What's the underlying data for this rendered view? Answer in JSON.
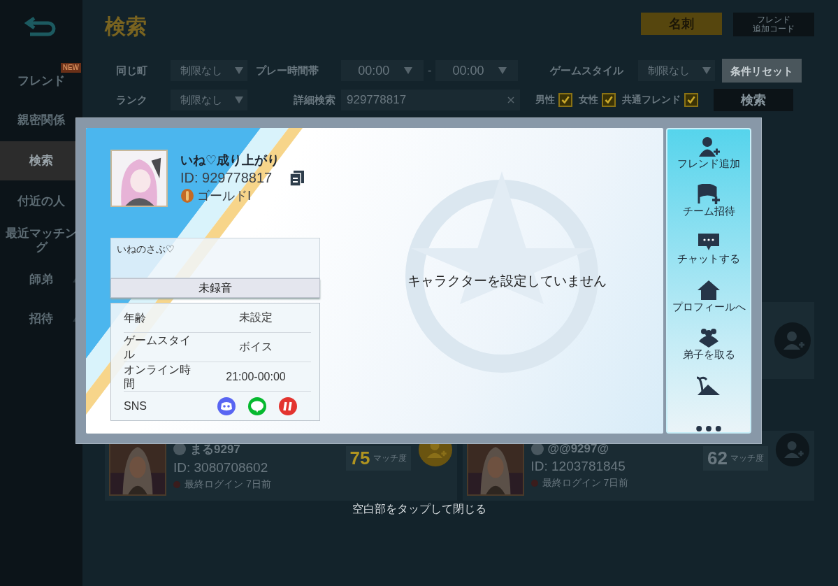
{
  "sidebar": {
    "items": [
      {
        "label": "フレンド",
        "selected": false,
        "badge": "NEW"
      },
      {
        "label": "親密関係",
        "selected": false
      },
      {
        "label": "検索",
        "selected": true
      },
      {
        "label": "付近の人",
        "selected": false
      },
      {
        "label": "最近マッチング",
        "selected": false
      },
      {
        "label": "師弟",
        "selected": false,
        "expandable": true
      },
      {
        "label": "招待",
        "selected": false,
        "expandable": true
      }
    ]
  },
  "header": {
    "title": "検索",
    "card_button": "名刺",
    "code_button": [
      "フレンド",
      "追加コード"
    ]
  },
  "filters": {
    "town_label": "同じ町",
    "town": "制限なし",
    "time_label": "プレー時間帯",
    "time_from": "00:00",
    "time_sep": "-",
    "time_to": "00:00",
    "style_label": "ゲームスタイル",
    "style": "制限なし",
    "reset_button": "条件リセット",
    "rank_label": "ランク",
    "rank": "制限なし",
    "detail_label": "詳細検索",
    "detail_value": "929778817",
    "checks": [
      {
        "label": "男性",
        "checked": true
      },
      {
        "label": "女性",
        "checked": true
      },
      {
        "label": "共通フレンド",
        "checked": true
      }
    ],
    "search_button": "検索"
  },
  "results": [
    {
      "name": "まる9297",
      "id": "ID: 3080708602",
      "last_login": "最終ログイン 7日前",
      "match": "75",
      "match_label": "マッチ度",
      "highlight": true
    },
    {
      "name": "@@9297@",
      "id": "ID: 1203781845",
      "last_login": "最終ログイン 7日前",
      "match": "62",
      "match_label": "マッチ度",
      "highlight": false
    }
  ],
  "modal": {
    "name": "いね♡成り上がり",
    "id": "ID: 929778817",
    "rank": "ゴールドⅠ",
    "bio": "いねのさぶ♡",
    "voice_button": "未録音",
    "info": [
      {
        "label": "年齢",
        "value": "未設定"
      },
      {
        "label": "ゲームスタイル",
        "value": "ボイス"
      },
      {
        "label": "オンライン時間",
        "value": "21:00-00:00"
      }
    ],
    "sns": {
      "label": "SNS",
      "links": [
        {
          "kind": "discord"
        },
        {
          "kind": "line"
        },
        {
          "kind": "other"
        }
      ]
    },
    "character_message": "キャラクターを設定していません",
    "actions": [
      {
        "kind": "add-friend",
        "label": "フレンド追加"
      },
      {
        "kind": "team",
        "label": "チーム招待"
      },
      {
        "kind": "chat",
        "label": "チャットする"
      },
      {
        "kind": "home",
        "label": "プロフィールへ"
      },
      {
        "kind": "mentor",
        "label": "弟子を取る"
      },
      {
        "kind": "island"
      }
    ],
    "close_hint": "空白部をタップして閉じる"
  }
}
